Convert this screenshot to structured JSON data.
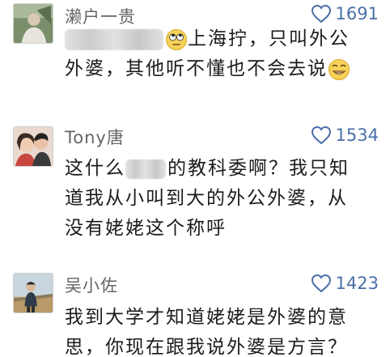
{
  "comments": [
    {
      "user": "濑户一贵",
      "likes": "1691",
      "lines": [
        "上海拧，只叫外公",
        "外婆，其他听不懂也不会去说"
      ]
    },
    {
      "user": "Tony唐",
      "likes": "1534",
      "lines": [
        "这什么",
        "的教科委啊？我只知",
        "道我从小叫到大的外公外婆，从",
        "没有姥姥这个称呼"
      ]
    },
    {
      "user": "吴小佐",
      "likes": "1423",
      "lines": [
        "我到大学才知道姥姥是外婆的意",
        "思，你现在跟我说外婆是方言？"
      ]
    }
  ],
  "icons": {
    "like": "heart-outline-icon",
    "emoji_1": "rolling-eyes-emoji-icon",
    "emoji_2": "smiling-emoji-icon"
  },
  "colors": {
    "like_count": "#4a6fa8",
    "username": "#666666",
    "text": "#1b1b1b"
  }
}
